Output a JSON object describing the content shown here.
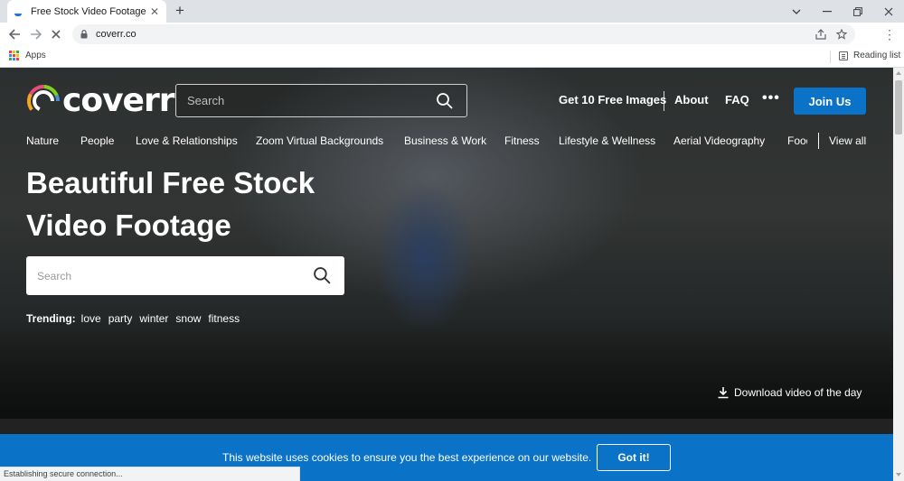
{
  "browser": {
    "tab_title": "Free Stock Video Footage, Royalty",
    "tab_close": "✕",
    "new_tab": "+",
    "url": "coverr.co",
    "bookmarks": {
      "apps": "Apps",
      "reading_list": "Reading list"
    },
    "status_text": "Establishing secure connection..."
  },
  "site": {
    "logo_text": "coverr",
    "top_search": {
      "placeholder": "Search"
    },
    "top_nav": {
      "free_images": "Get 10 Free Images",
      "about": "About",
      "faq": "FAQ",
      "more": "•••",
      "join": "Join Us"
    },
    "categories": [
      {
        "label": "Nature"
      },
      {
        "label": "People"
      },
      {
        "label": "Love & Relationships"
      },
      {
        "label": "Zoom Virtual Backgrounds"
      },
      {
        "label": "Business & Work"
      },
      {
        "label": "Fitness"
      },
      {
        "label": "Lifestyle & Wellness"
      },
      {
        "label": "Aerial Videography"
      },
      {
        "label": "Food"
      }
    ],
    "view_all": "View all",
    "headline_line1": "Beautiful Free Stock",
    "headline_line2": "Video Footage",
    "hero_search": {
      "placeholder": "Search"
    },
    "trending": {
      "label": "Trending:",
      "words": [
        "love",
        "party",
        "winter",
        "snow",
        "fitness"
      ]
    },
    "download_label": "Download video of the day"
  },
  "cookie_banner": {
    "text": "This website uses cookies to ensure you the best experience on our website.",
    "button": "Got it!"
  },
  "colors": {
    "accent_blue": "#0a72c7",
    "chrome_tabstrip": "#dee1e6",
    "omnibox": "#f1f3f4"
  }
}
